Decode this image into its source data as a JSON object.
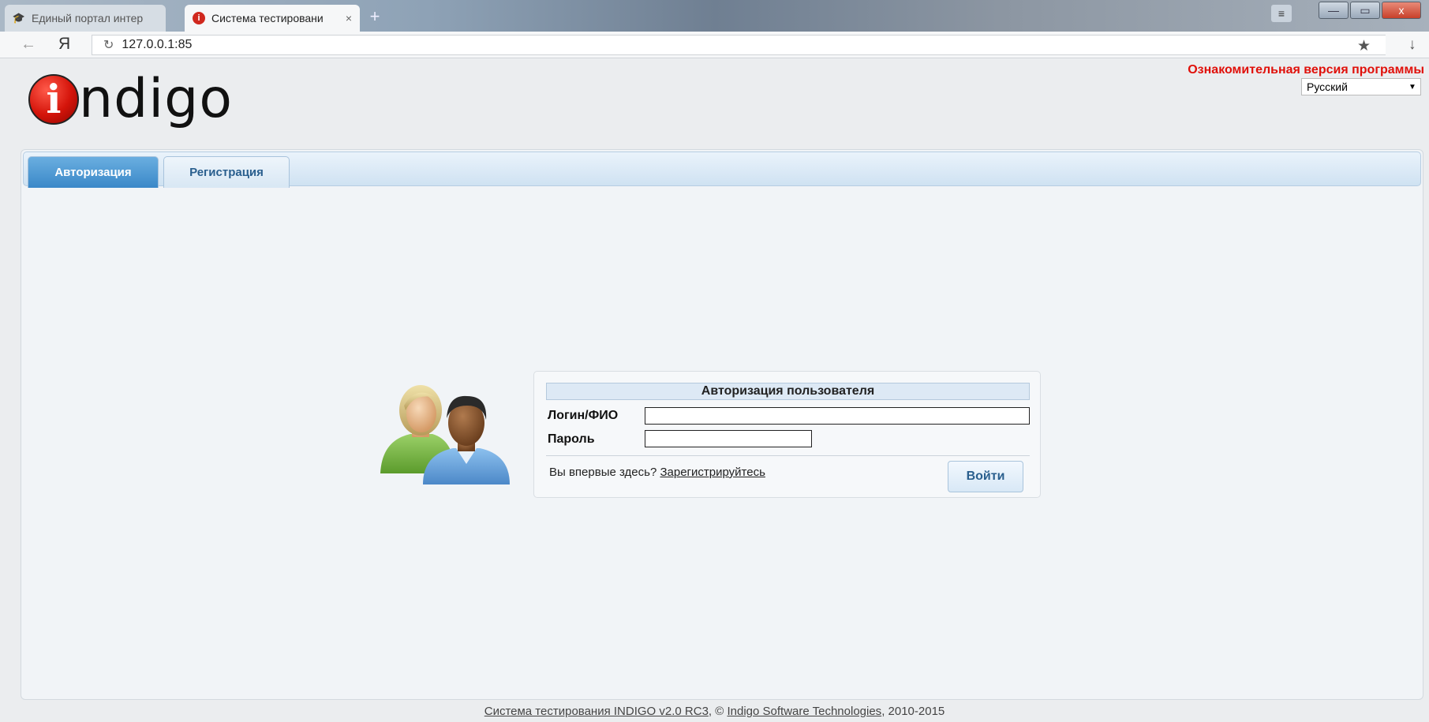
{
  "browser": {
    "tabs": [
      {
        "title": "Единый портал интер",
        "active": false,
        "icon": "graduation-cap-icon"
      },
      {
        "title": "Система тестировани",
        "active": true,
        "icon": "indigo-favicon",
        "close": "×"
      }
    ],
    "new_tab": "+",
    "menu_glyph": "≡",
    "window_buttons": {
      "minimize": "—",
      "maximize": "▭",
      "close": "x"
    },
    "back_glyph": "←",
    "yandex": "Я",
    "reload_glyph": "↻",
    "url": "127.0.0.1:85",
    "star_glyph": "★",
    "download_glyph": "↓"
  },
  "header": {
    "logo_letter": "i",
    "logo_text": "ndigo",
    "trial_notice": "Ознакомительная версия программы",
    "language": {
      "selected": "Русский",
      "arrow": "▼"
    }
  },
  "tabs": [
    {
      "label": "Авторизация",
      "active": true
    },
    {
      "label": "Регистрация",
      "active": false
    }
  ],
  "login": {
    "title": "Авторизация пользователя",
    "login_label": "Логин/ФИО",
    "login_value": "",
    "password_label": "Пароль",
    "password_value": "",
    "first_time_text": "Вы впервые здесь?",
    "register_link": "Зарегистрируйтесь",
    "submit_label": "Войти"
  },
  "footer": {
    "product_link": "Система тестирования INDIGO v2.0 RC3",
    "middle": ", © ",
    "company_link": "Indigo Software Technologies",
    "years": ", 2010-2015"
  },
  "colors": {
    "trial_red": "#e0100a",
    "tab_active": "#3a88c8",
    "tab_text": "#2a5f8e",
    "logo_red": "#d4140a"
  }
}
